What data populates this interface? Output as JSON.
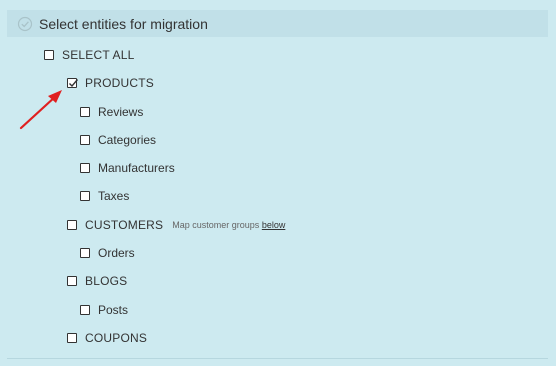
{
  "header": {
    "title": "Select entities for migration",
    "icon": "check-circle-icon"
  },
  "select_all": {
    "label": "SELECT ALL",
    "checked": false
  },
  "entities": {
    "products": {
      "label": "PRODUCTS",
      "checked": true
    },
    "reviews": {
      "label": "Reviews",
      "checked": false
    },
    "categories": {
      "label": "Categories",
      "checked": false
    },
    "manufacturers": {
      "label": "Manufacturers",
      "checked": false
    },
    "taxes": {
      "label": "Taxes",
      "checked": false
    },
    "customers": {
      "label": "CUSTOMERS",
      "checked": false,
      "hint": "Map customer groups",
      "hint_link": "below"
    },
    "orders": {
      "label": "Orders",
      "checked": false
    },
    "blogs": {
      "label": "BLOGS",
      "checked": false
    },
    "posts": {
      "label": "Posts",
      "checked": false
    },
    "coupons": {
      "label": "COUPONS",
      "checked": false
    }
  },
  "colors": {
    "background": "#cdeaf0",
    "header_bg": "#c1e0e8",
    "arrow": "#e02020"
  }
}
